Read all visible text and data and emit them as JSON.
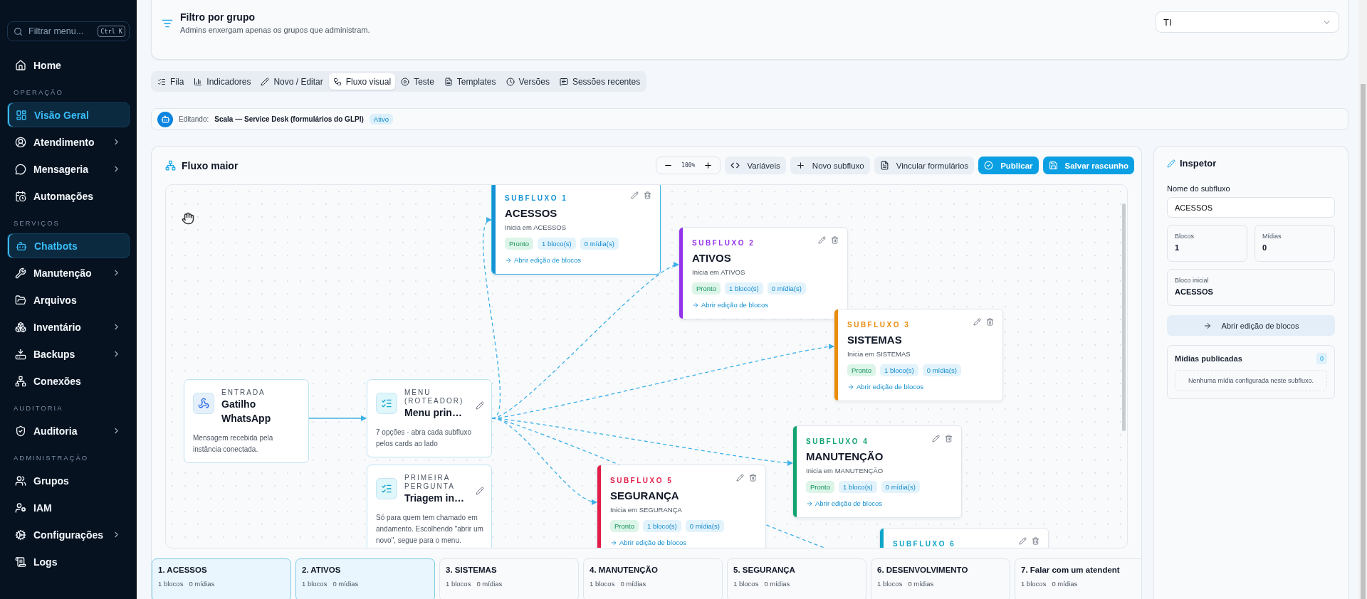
{
  "sidebar": {
    "search": {
      "placeholder": "Filtrar menu...",
      "shortcut": "Ctrl K"
    },
    "sections": [
      {
        "items": [
          {
            "label": "Home",
            "selected": false,
            "submenu": false
          }
        ]
      },
      {
        "title": "OPERAÇÃO",
        "items": [
          {
            "label": "Visão Geral",
            "selected": true,
            "submenu": false
          },
          {
            "label": "Atendimento",
            "selected": false,
            "submenu": true
          },
          {
            "label": "Mensageria",
            "selected": false,
            "submenu": true
          },
          {
            "label": "Automações",
            "selected": false,
            "submenu": false
          }
        ]
      },
      {
        "title": "SERVIÇOS",
        "items": [
          {
            "label": "Chatbots",
            "selected": true,
            "submenu": false
          },
          {
            "label": "Manutenção",
            "selected": false,
            "submenu": true
          },
          {
            "label": "Arquivos",
            "selected": false,
            "submenu": false
          },
          {
            "label": "Inventário",
            "selected": false,
            "submenu": true
          },
          {
            "label": "Backups",
            "selected": false,
            "submenu": true
          },
          {
            "label": "Conexões",
            "selected": false,
            "submenu": false
          }
        ]
      },
      {
        "title": "AUDITORIA",
        "items": [
          {
            "label": "Auditoria",
            "selected": false,
            "submenu": true
          }
        ]
      },
      {
        "title": "ADMINISTRAÇÃO",
        "items": [
          {
            "label": "Grupos",
            "selected": false,
            "submenu": false
          },
          {
            "label": "IAM",
            "selected": false,
            "submenu": false
          },
          {
            "label": "Configurações",
            "selected": false,
            "submenu": true
          },
          {
            "label": "Logs",
            "selected": false,
            "submenu": false
          }
        ]
      }
    ]
  },
  "group_filter": {
    "title": "Filtro por grupo",
    "subtitle": "Admins enxergam apenas os grupos que administram.",
    "value": "TI"
  },
  "tabs": [
    {
      "label": "Fila",
      "selected": false
    },
    {
      "label": "Indicadores",
      "selected": false
    },
    {
      "label": "Novo / Editar",
      "selected": false
    },
    {
      "label": "Fluxo visual",
      "selected": true
    },
    {
      "label": "Teste",
      "selected": false
    },
    {
      "label": "Templates",
      "selected": false
    },
    {
      "label": "Versões",
      "selected": false
    },
    {
      "label": "Sessões recentes",
      "selected": false
    }
  ],
  "editing": {
    "label": "Editando:",
    "name": "Scala — Service Desk (formulários do GLPI)",
    "status": "Ativo"
  },
  "flow": {
    "title": "Fluxo maior",
    "zoom": "100%",
    "actions": [
      {
        "label": "Variáveis",
        "kind": "secondary"
      },
      {
        "label": "Novo subfluxo",
        "kind": "secondary"
      },
      {
        "label": "Vincular formulários",
        "kind": "secondary"
      },
      {
        "label": "Publicar",
        "kind": "primary"
      },
      {
        "label": "Salvar rascunho",
        "kind": "primary"
      }
    ],
    "nodes": [
      {
        "kind": "trigger",
        "label": "ENTRADA",
        "title": "Gatilho WhatsApp",
        "description": "Mensagem recebida pela instância conectada."
      },
      {
        "kind": "menu",
        "label": "MENU (ROTEADOR)",
        "title": "Menu prin…",
        "description": "7 opções · abra cada subfluxo pelos cards ao lado"
      },
      {
        "kind": "question",
        "label": "PRIMEIRA PERGUNTA",
        "title": "Triagem in…",
        "description": "Só para quem tem chamado em andamento. Escolhendo \"abrir um novo\", segue para o menu."
      }
    ],
    "subflows": [
      {
        "label": "SUBFLUXO 1",
        "title": "ACESSOS",
        "start": "Inicia em ACESSOS",
        "status": "Pronto",
        "blocks": "1 bloco(s)",
        "media": "0 mídia(s)",
        "link": "Abrir edição de blocos",
        "color": "#1592d4",
        "selected": true
      },
      {
        "label": "SUBFLUXO 2",
        "title": "ATIVOS",
        "start": "Inicia em ATIVOS",
        "status": "Pronto",
        "blocks": "1 bloco(s)",
        "media": "0 mídia(s)",
        "link": "Abrir edição de blocos",
        "color": "#9333ea",
        "selected": false
      },
      {
        "label": "SUBFLUXO 3",
        "title": "SISTEMAS",
        "start": "Inicia em SISTEMAS",
        "status": "Pronto",
        "blocks": "1 bloco(s)",
        "media": "0 mídia(s)",
        "link": "Abrir edição de blocos",
        "color": "#ea8c0c",
        "selected": false
      },
      {
        "label": "SUBFLUXO 4",
        "title": "MANUTENÇÃO",
        "start": "Inicia em MANUTENÇÃO",
        "status": "Pronto",
        "blocks": "1 bloco(s)",
        "media": "0 mídia(s)",
        "link": "Abrir edição de blocos",
        "color": "#10a36f",
        "selected": false
      },
      {
        "label": "SUBFLUXO 5",
        "title": "SEGURANÇA",
        "start": "Inicia em SEGURANÇA",
        "status": "Pronto",
        "blocks": "1 bloco(s)",
        "media": "0 mídia(s)",
        "link": "Abrir edição de blocos",
        "color": "#e11d48",
        "selected": false
      },
      {
        "label": "SUBFLUXO 6",
        "color": "#0ea5c9",
        "selected": false
      }
    ]
  },
  "subflow_cards": [
    {
      "title": "1. ACESSOS",
      "blocks": "1 blocos",
      "media": "0 mídias",
      "selected": true
    },
    {
      "title": "2. ATIVOS",
      "blocks": "1 blocos",
      "media": "0 mídias",
      "selected": true
    },
    {
      "title": "3. SISTEMAS",
      "blocks": "1 blocos",
      "media": "0 mídias",
      "selected": false
    },
    {
      "title": "4. MANUTENÇÃO",
      "blocks": "1 blocos",
      "media": "0 mídias",
      "selected": false
    },
    {
      "title": "5. SEGURANÇA",
      "blocks": "1 blocos",
      "media": "0 mídias",
      "selected": false
    },
    {
      "title": "6. DESENVOLVIMENTO",
      "blocks": "1 blocos",
      "media": "0 mídias",
      "selected": false
    },
    {
      "title": "7. Falar com um atendent",
      "blocks": "1 blocos",
      "media": "0 mídias",
      "selected": false
    }
  ],
  "inspector": {
    "title": "Inspetor",
    "name_label": "Nome do subfluxo",
    "name_value": "ACESSOS",
    "stats": [
      {
        "label": "Blocos",
        "value": "1"
      },
      {
        "label": "Mídias",
        "value": "0"
      }
    ],
    "start_label": "Bloco inicial",
    "start_value": "ACESSOS",
    "open_button": "Abrir edição de blocos",
    "media": {
      "title": "Mídias publicadas",
      "count": "0",
      "empty": "Nenhuma mídia configurada neste subfluxo."
    }
  }
}
